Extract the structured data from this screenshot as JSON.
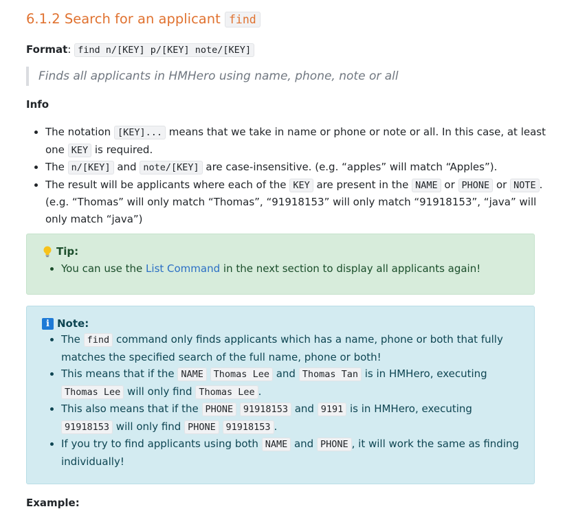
{
  "heading": {
    "title": "6.1.2 Search for an applicant",
    "code": "find"
  },
  "format": {
    "label": "Format",
    "colon": ":",
    "command": "find n/[KEY] p/[KEY] note/[KEY]"
  },
  "description": "Finds all applicants in HMHero using name, phone, note or all",
  "info": {
    "title": "Info",
    "items": [
      {
        "t1": "The notation ",
        "c1": "[KEY]...",
        "t2": " means that we take in name or phone or note or all. In this case, at least one ",
        "c2": "KEY",
        "t3": " is required."
      },
      {
        "t1": "The ",
        "c1": "n/[KEY]",
        "t2": " and ",
        "c2": "note/[KEY]",
        "t3": " are case-insensitive. (e.g. “apples” will match “Apples”)."
      },
      {
        "t1": "The result will be applicants where each of the ",
        "c1": "KEY",
        "t2": " are present in the ",
        "c2": "NAME",
        "t3": " or ",
        "c3": "PHONE",
        "t4": " or ",
        "c4": "NOTE",
        "t5": ". (e.g. “Thomas” will only match “Thomas”, “91918153” will only match “91918153”, “java” will only match “java”)"
      }
    ]
  },
  "tip": {
    "title": "Tip:",
    "icon": "lightbulb-icon",
    "item": {
      "t1": "You can use the ",
      "link": "List Command",
      "t2": " in the next section to display all applicants again!"
    },
    "colors": {
      "bg": "#d7ecdb",
      "text": "#1a4d2a"
    }
  },
  "note": {
    "title": "Note:",
    "icon": "info-icon",
    "icon_glyph": "i",
    "colors": {
      "bg": "#d3ebf1",
      "text": "#0e4552"
    },
    "items": [
      {
        "t1": "The ",
        "c1": "find",
        "t2": " command only finds applicants which has a name, phone or both that fully matches the specified search of the full name, phone or both!"
      },
      {
        "t1": "This means that if the ",
        "c1": "NAME",
        "t2": " ",
        "c2": "Thomas Lee",
        "t3": " and ",
        "c3": "Thomas Tan",
        "t4": " is in HMHero, executing ",
        "c4": "Thomas Lee",
        "t5": " will only find ",
        "c5": "Thomas Lee",
        "t6": "."
      },
      {
        "t1": "This also means that if the ",
        "c1": "PHONE",
        "t2": " ",
        "c2": "91918153",
        "t3": " and ",
        "c3": "9191",
        "t4": " is in HMHero, executing ",
        "c4": "91918153",
        "t5": " will only find ",
        "c5": "PHONE",
        "t6": " ",
        "c6": "91918153",
        "t7": "."
      },
      {
        "t1": "If you try to find applicants using both ",
        "c1": "NAME",
        "t2": " and ",
        "c2": "PHONE",
        "t3": ", it will work the same as finding individually!"
      }
    ]
  },
  "next_heading": "Example:"
}
